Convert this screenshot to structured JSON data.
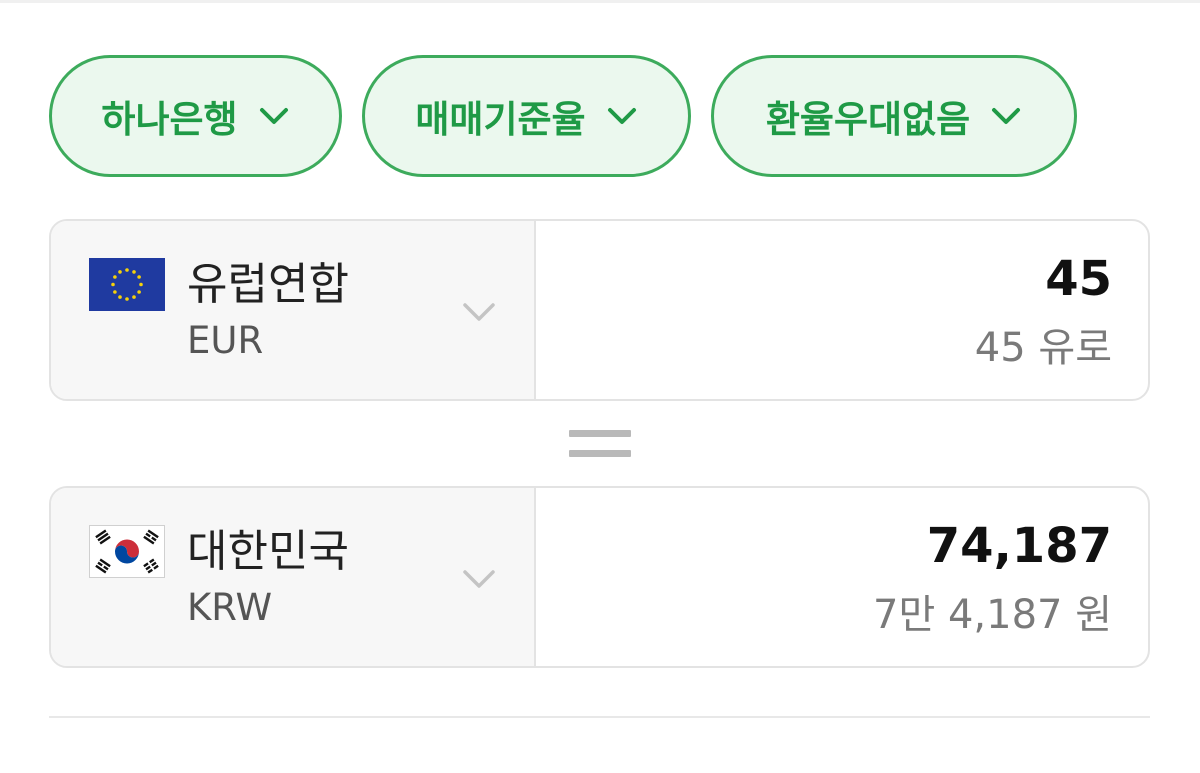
{
  "filters": [
    {
      "label": "하나은행",
      "icon": "chevron-down-icon"
    },
    {
      "label": "매매기준율",
      "icon": "chevron-down-icon"
    },
    {
      "label": "환율우대없음",
      "icon": "chevron-down-icon"
    }
  ],
  "from": {
    "flag": "eu-flag-icon",
    "country": "유럽연합",
    "code": "EUR",
    "amount": "45",
    "amount_words": "45 유로"
  },
  "to": {
    "flag": "korea-flag-icon",
    "country": "대한민국",
    "code": "KRW",
    "amount": "74,187",
    "amount_words": "7만 4,187 원"
  },
  "colors": {
    "accent": "#1f9a46",
    "chip_border": "#3dab5c",
    "chip_bg": "#ebf8ee"
  }
}
